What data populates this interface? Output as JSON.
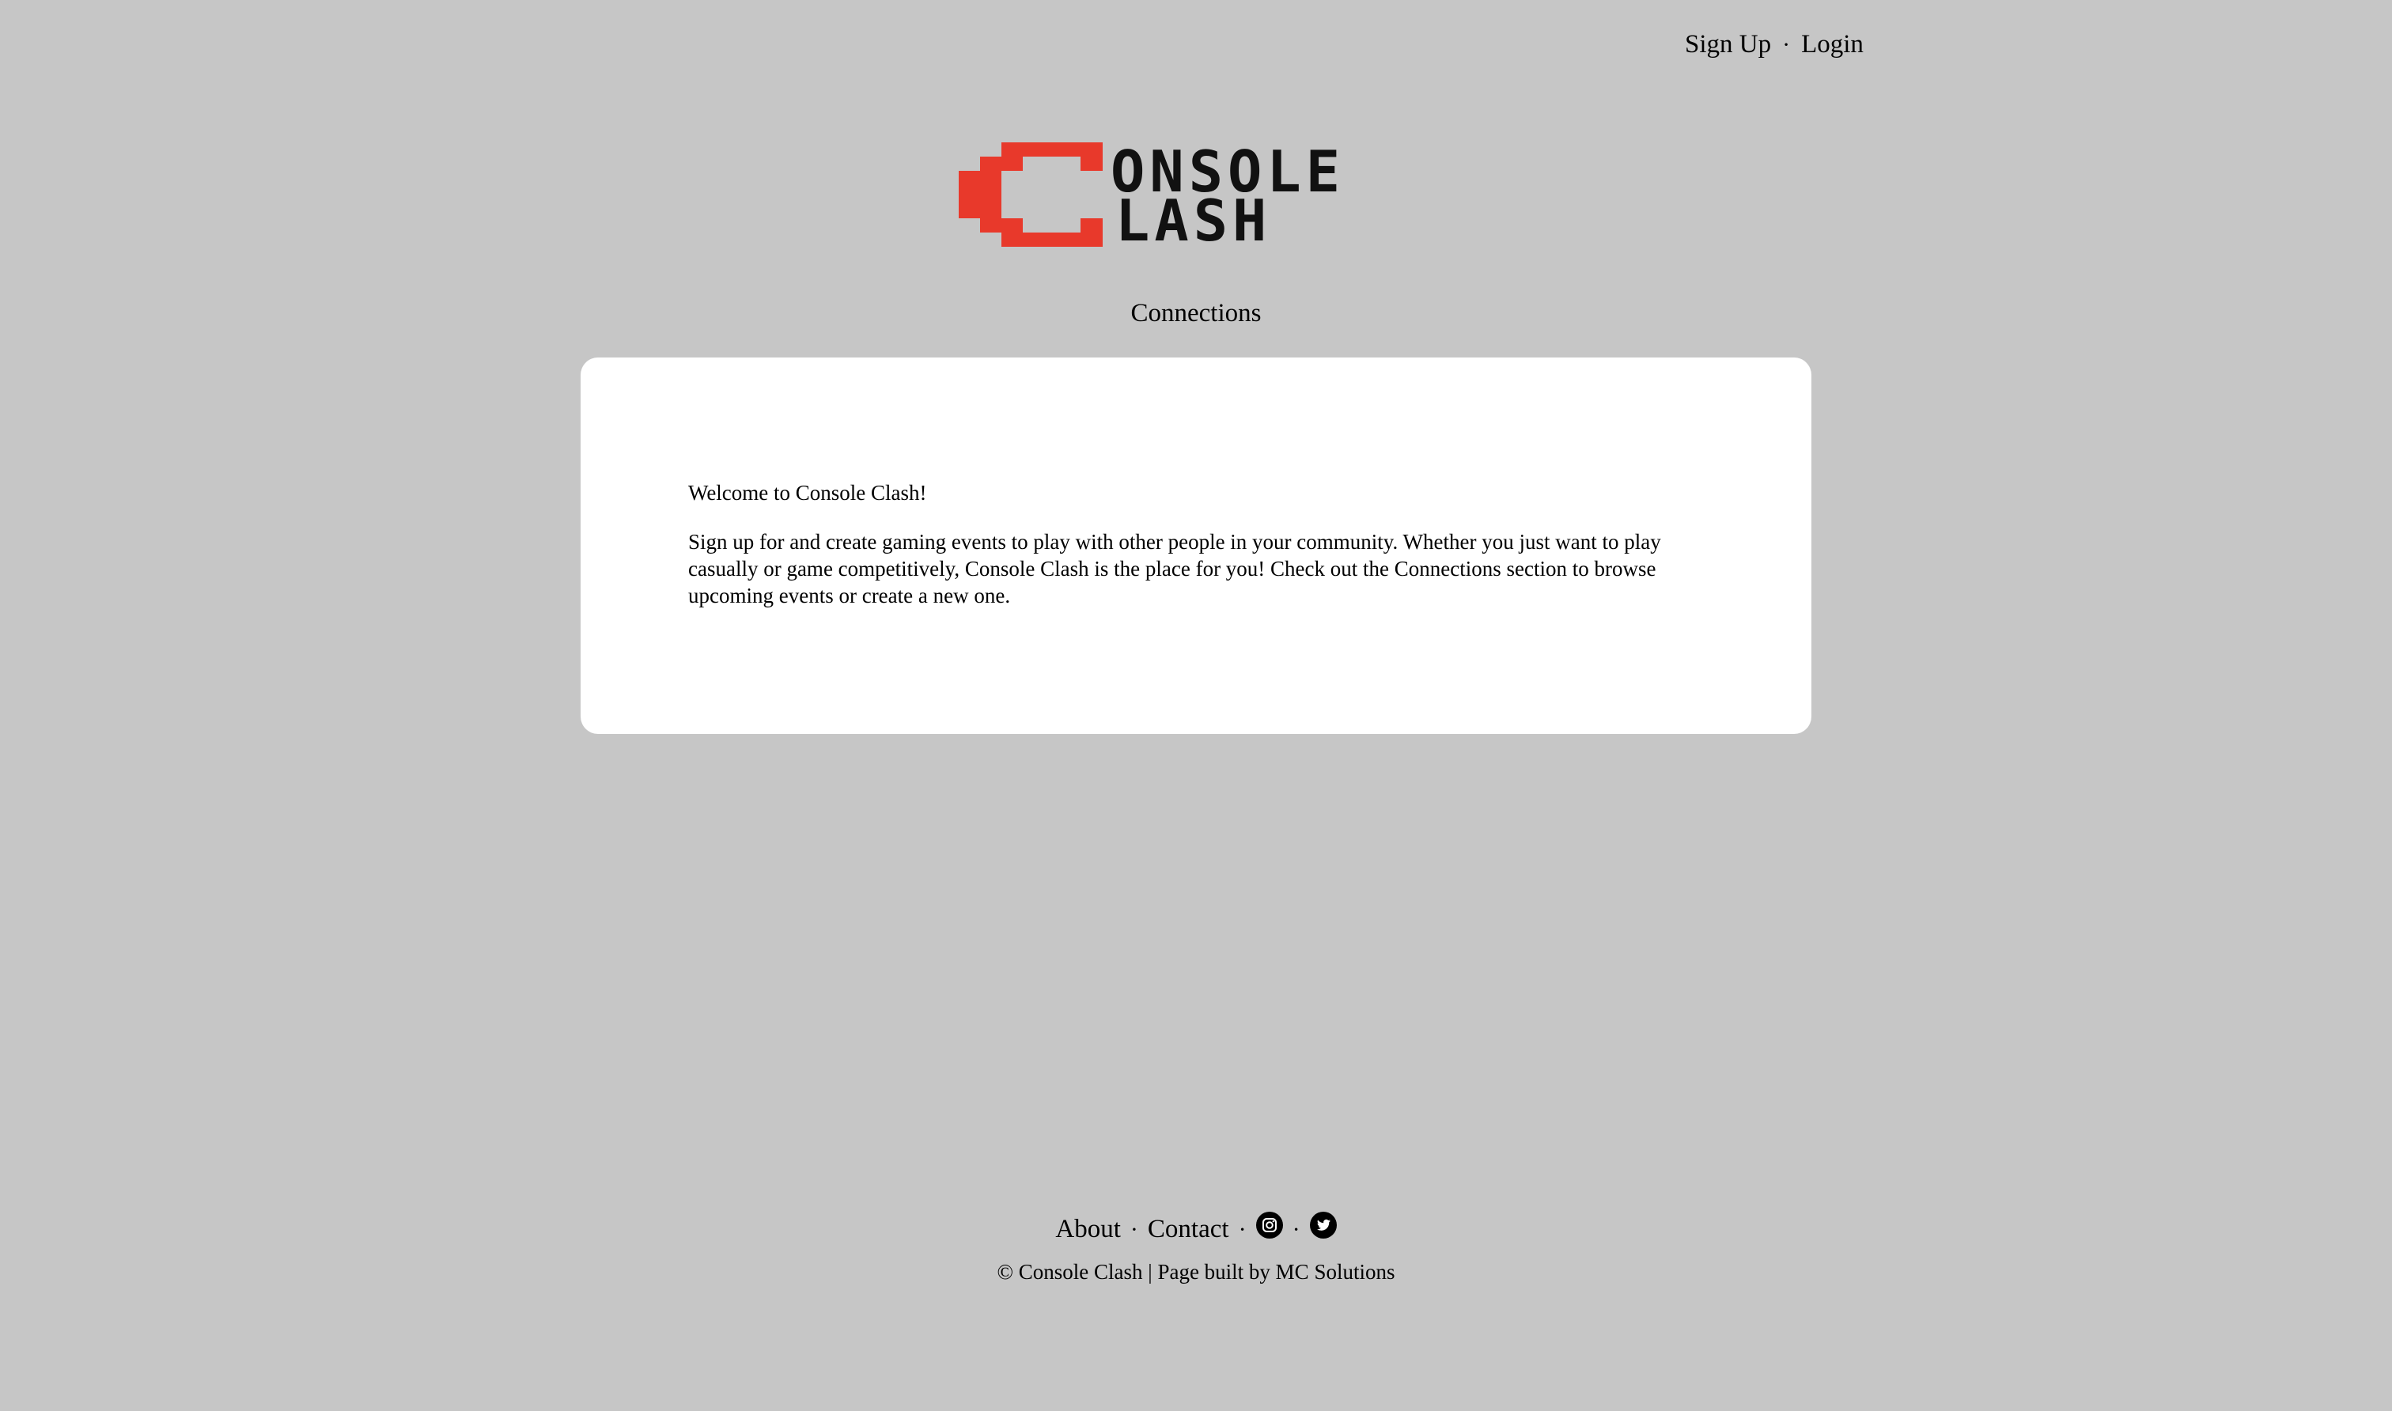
{
  "header": {
    "signup_label": "Sign Up",
    "separator": "·",
    "login_label": "Login"
  },
  "logo": {
    "text_line1": "ONSOLE",
    "text_line2": "LASH",
    "brand_color": "#e8392b"
  },
  "nav": {
    "connections_label": "Connections"
  },
  "main": {
    "welcome_heading": "Welcome to Console Clash!",
    "description": "Sign up for and create gaming events to play with other people in your community. Whether you just want to play casually or game competitively, Console Clash is the place for you! Check out the Connections section to browse upcoming events or create a new one."
  },
  "footer": {
    "about_label": "About",
    "contact_label": "Contact",
    "separator": "·",
    "instagram_icon": "instagram-icon",
    "twitter_icon": "twitter-icon",
    "copyright": "© Console Clash | Page built by MC Solutions"
  },
  "colors": {
    "background": "#c6c6c6",
    "card": "#ffffff",
    "text": "#000000",
    "brand_red": "#e8392b"
  }
}
